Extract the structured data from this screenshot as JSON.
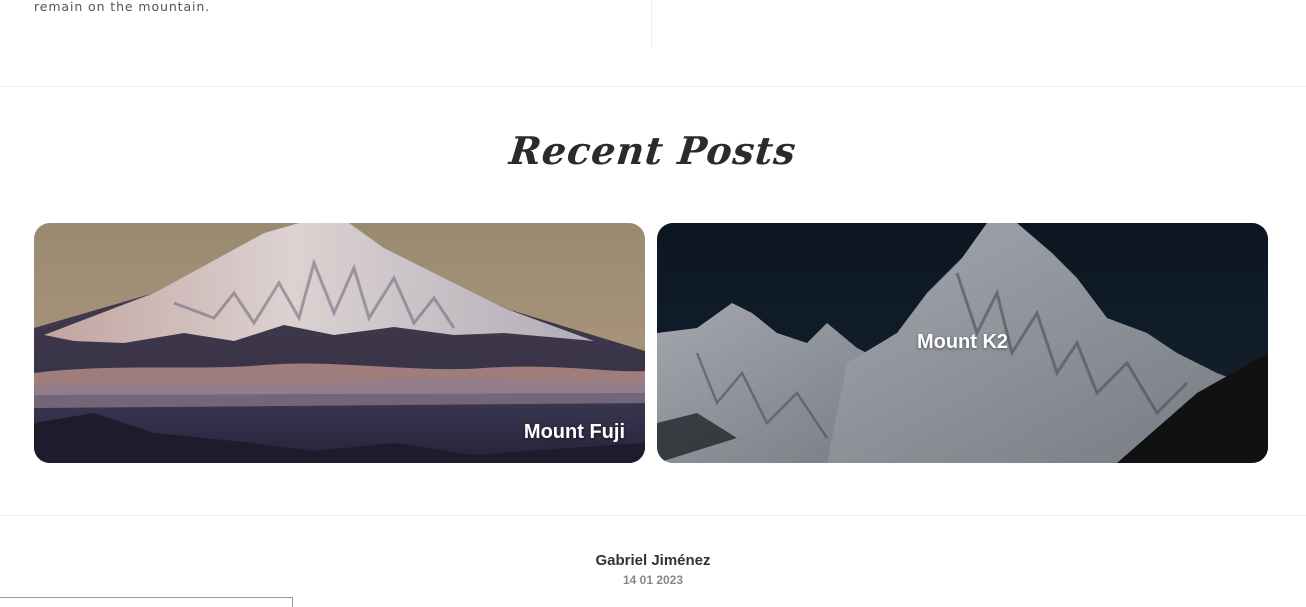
{
  "intro": {
    "text": "remain on the mountain."
  },
  "recent_posts": {
    "title": "Recent Posts",
    "posts": [
      {
        "title": "Mount Fuji"
      },
      {
        "title": "Mount K2"
      }
    ]
  },
  "footer": {
    "author": "Gabriel Jiménez",
    "date": "14 01 2023"
  }
}
